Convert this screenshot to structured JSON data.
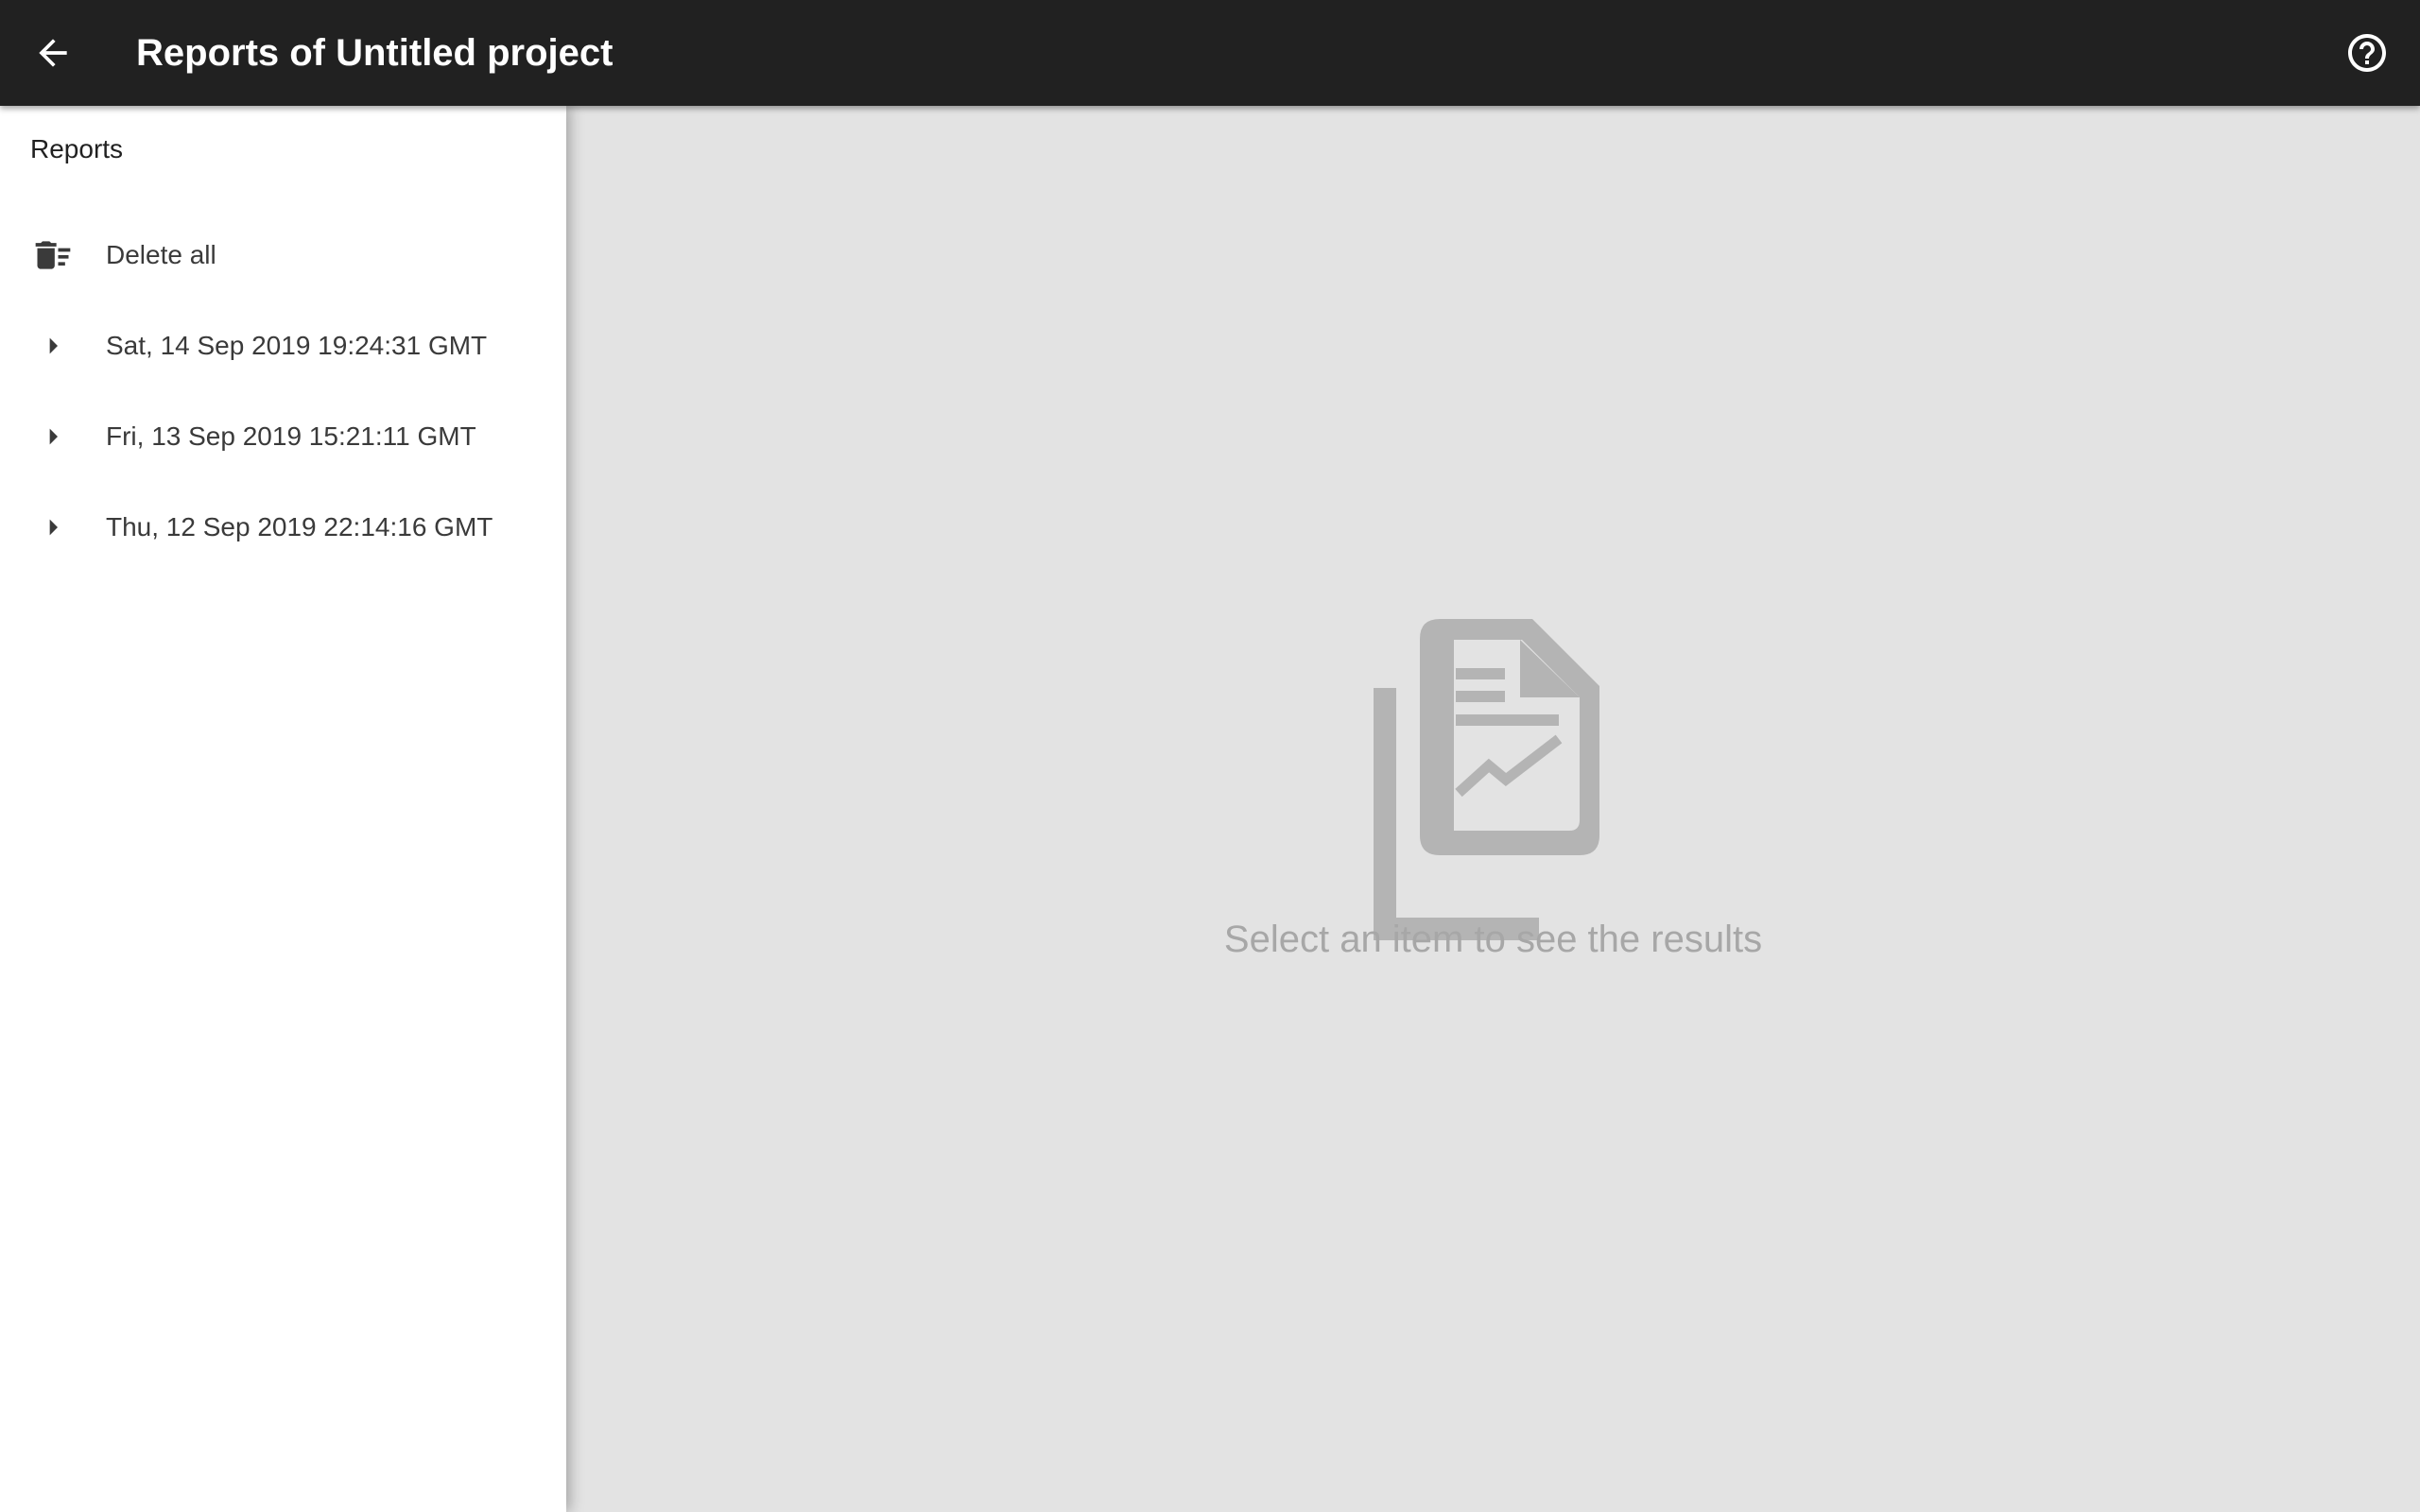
{
  "header": {
    "title": "Reports of Untitled project",
    "back_icon": "arrow-back-icon",
    "help_icon": "help-circle-icon"
  },
  "sidebar": {
    "heading": "Reports",
    "delete_all": {
      "label": "Delete all",
      "icon": "delete-sweep-icon"
    },
    "items": [
      {
        "label": "Sat, 14 Sep 2019 19:24:31 GMT",
        "icon": "caret-right-icon"
      },
      {
        "label": "Fri, 13 Sep 2019 15:21:11 GMT",
        "icon": "caret-right-icon"
      },
      {
        "label": "Thu, 12 Sep 2019 22:14:16 GMT",
        "icon": "caret-right-icon"
      }
    ]
  },
  "main": {
    "empty_icon": "report-document-icon",
    "empty_message": "Select an item to see the results"
  },
  "colors": {
    "appbar": "#212121",
    "sidebar": "#ffffff",
    "main_background": "#e3e3e3",
    "empty_state": "#b4b4b4"
  }
}
